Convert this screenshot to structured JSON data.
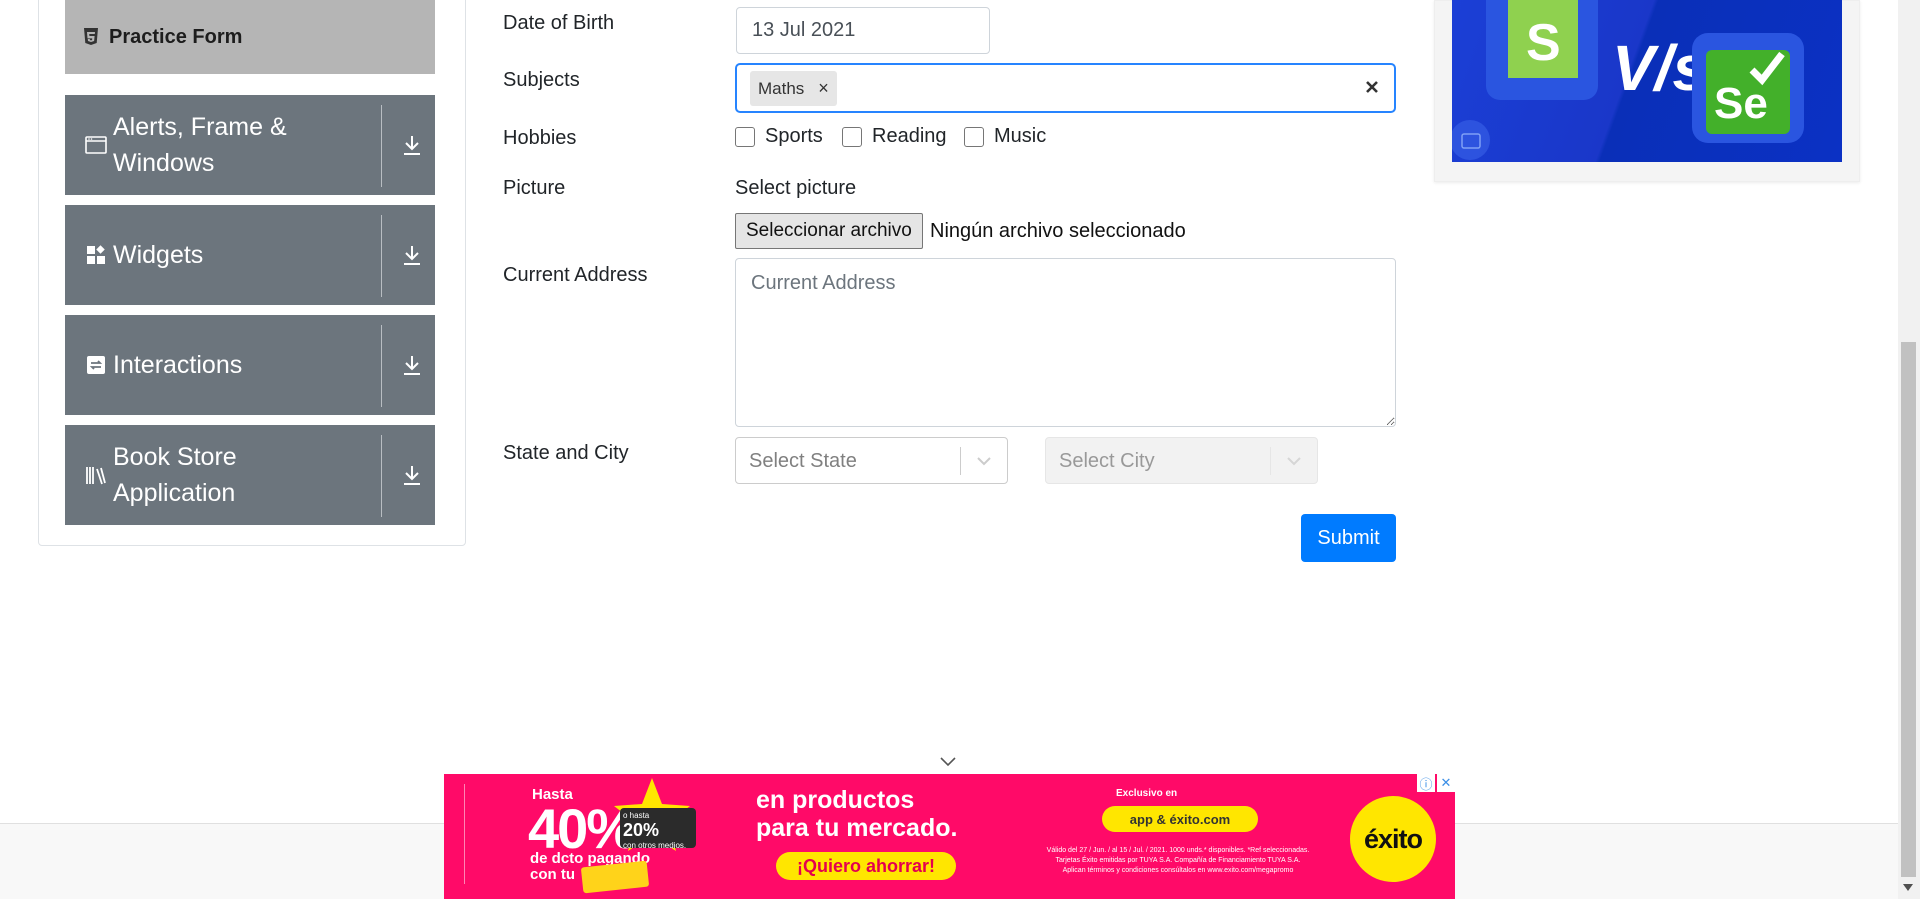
{
  "sidebar": {
    "active_item": {
      "label": "Practice Form",
      "icon": "html5-icon"
    },
    "groups": [
      {
        "label": "Alerts, Frame & Windows",
        "icon": "window-icon"
      },
      {
        "label": "Widgets",
        "icon": "widgets-icon"
      },
      {
        "label": "Interactions",
        "icon": "interactions-icon"
      },
      {
        "label": "Book Store Application",
        "icon": "books-icon"
      }
    ]
  },
  "form": {
    "dob": {
      "label": "Date of Birth",
      "value": "13 Jul 2021"
    },
    "subjects": {
      "label": "Subjects",
      "chips": [
        "Maths"
      ],
      "chip_remove": "×"
    },
    "hobbies": {
      "label": "Hobbies",
      "options": [
        "Sports",
        "Reading",
        "Music"
      ]
    },
    "picture": {
      "label": "Picture",
      "hint": "Select picture",
      "button": "Seleccionar archivo",
      "status": "Ningún archivo seleccionado"
    },
    "address": {
      "label": "Current Address",
      "placeholder": "Current Address"
    },
    "state_city": {
      "label": "State and City",
      "state_placeholder": "Select State",
      "city_placeholder": "Select City"
    },
    "submit": "Submit"
  },
  "ad_banner": {
    "left": {
      "prefix": "Hasta",
      "percent": "40%",
      "line1": "de dcto pagando",
      "line2": "con tu",
      "badge_pre": "o hasta",
      "badge_pct": "20%",
      "badge_post": "con otros medios."
    },
    "center": {
      "line1": "en productos",
      "line2": "para tu mercado.",
      "cta": "¡Quiero ahorrar!"
    },
    "right": {
      "exclusive": "Exclusivo en",
      "app": "app & éxito.com",
      "legal1": "Válido del 27 / Jun. / al 15 / Jul. / 2021. 1000 unds.* disponibles. *Ref seleccionadas.",
      "legal2": "Tarjetas Éxito emitidas por TUYA S.A. Compañía de Financiamiento TUYA S.A.",
      "legal3": "Aplican términos y condiciones consúltalos en www.exito.com/megapromo"
    },
    "brand": "éxito"
  },
  "colors": {
    "primary": "#007bff",
    "sidebar_group": "#6c757d",
    "sidebar_active": "#b5b5b5",
    "banner": "#ff0a68",
    "focus": "#2684ff"
  }
}
